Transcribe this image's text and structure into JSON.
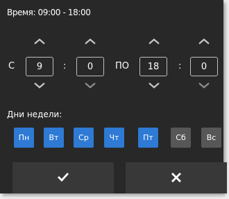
{
  "title": "Время: 09:00 - 18:00",
  "labels": {
    "from": "С",
    "to": "ПО",
    "sep1": ":",
    "sep2": ":"
  },
  "fields": {
    "start_hour": "9",
    "start_minute": "0",
    "end_hour": "18",
    "end_minute": "0"
  },
  "arrows": {
    "up_color": "#c6c6c6",
    "down_color": "#8e8e8e"
  },
  "days_label": "Дни недели:",
  "days": [
    {
      "label": "Пн",
      "active": true
    },
    {
      "label": "Вт",
      "active": true
    },
    {
      "label": "Ср",
      "active": true
    },
    {
      "label": "Чт",
      "active": true
    },
    {
      "label": "Пт",
      "active": true
    },
    {
      "label": "Сб",
      "active": false
    },
    {
      "label": "Вс",
      "active": false
    }
  ],
  "colors": {
    "panel": "#282828",
    "day_active": "#2e7ad4",
    "day_inactive": "#575757",
    "action_button": "#383838"
  },
  "actions": {
    "confirm_icon": "check-icon",
    "cancel_icon": "close-icon"
  }
}
